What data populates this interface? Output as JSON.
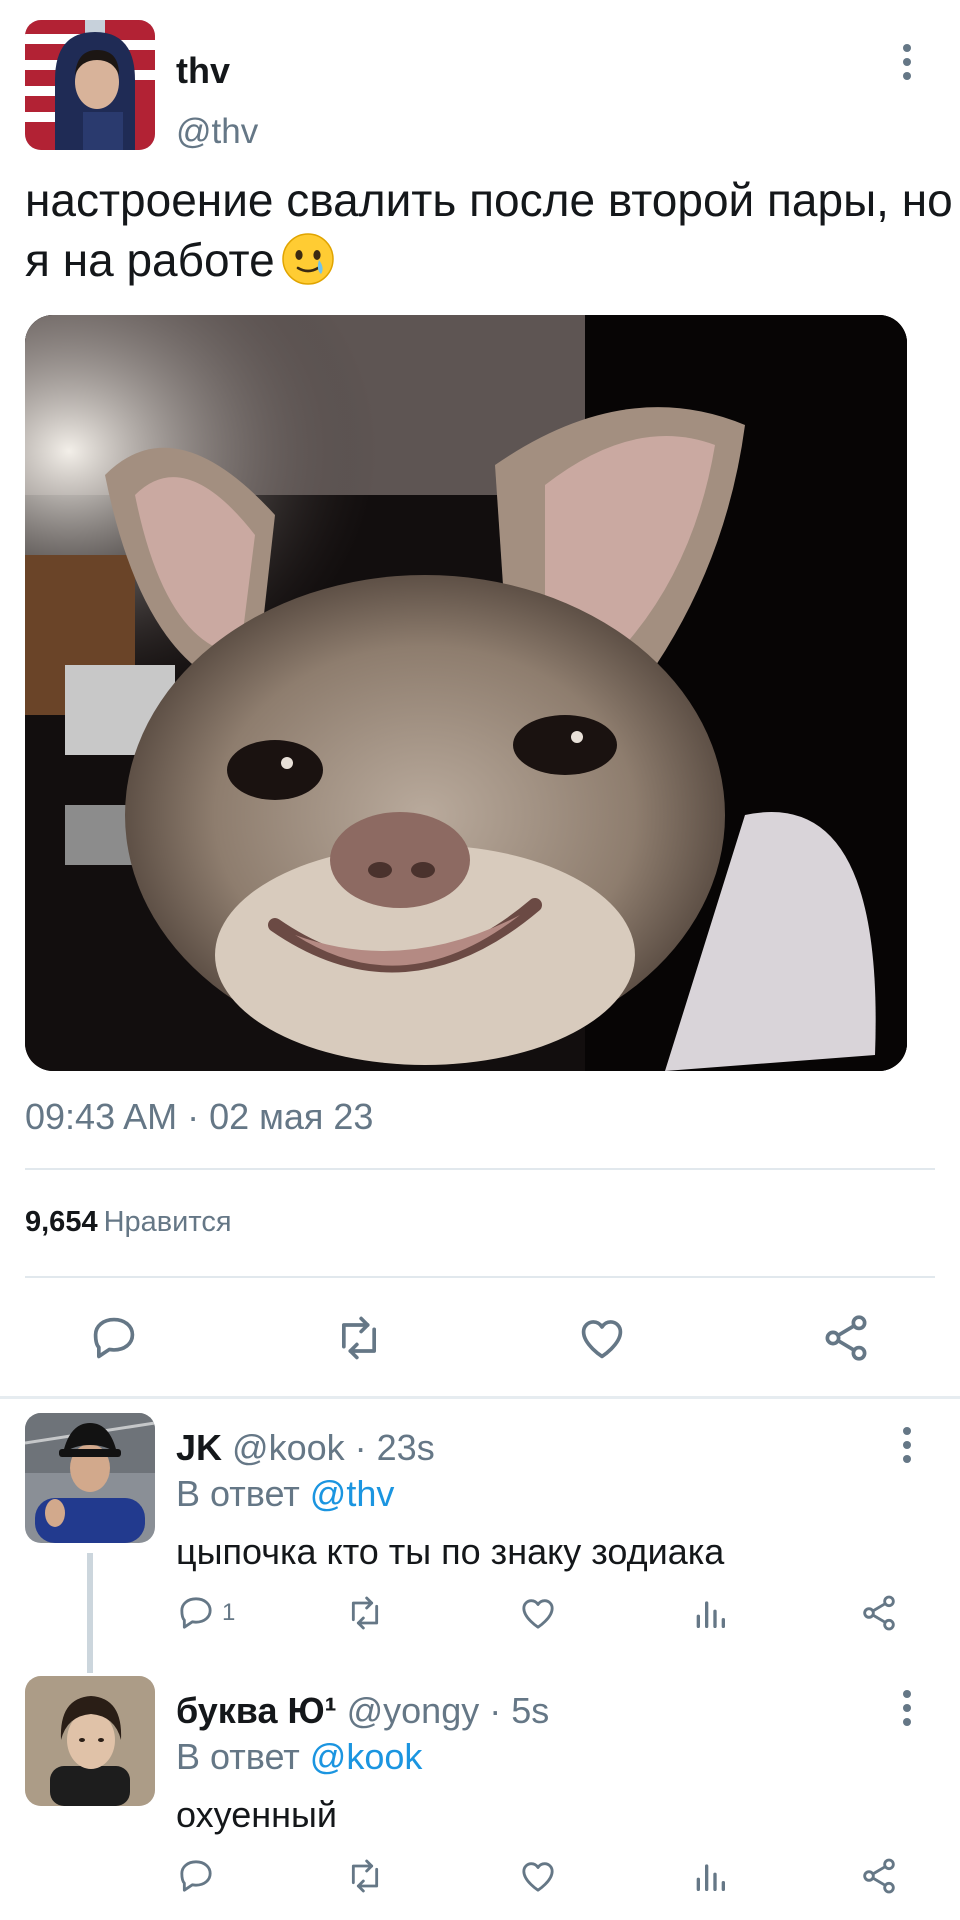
{
  "tweet": {
    "author_name": "thv",
    "author_handle": "@thv",
    "text": "настроение свалить после второй пары, но я на работе",
    "timestamp": "09:43 AM · 02 мая 23",
    "likes_count": "9,654",
    "likes_label": "Нравится",
    "emoji": "face-holding-back-tears"
  },
  "replies": [
    {
      "name": "JK",
      "handle": "@kook",
      "time": "· 23s",
      "replying_prefix": "В ответ",
      "replying_to": "@thv",
      "text": "цыпочка кто ты по знаку зодиака",
      "reply_count": "1"
    },
    {
      "name": "буква Ю¹",
      "handle": "@yongy",
      "time": "· 5s",
      "replying_prefix": "В ответ",
      "replying_to": "@kook",
      "text": "охуенный",
      "reply_count": ""
    }
  ],
  "icons": {
    "actions": [
      "reply-icon",
      "retweet-icon",
      "like-icon",
      "share-icon"
    ],
    "reply_actions": [
      "reply-icon",
      "retweet-icon",
      "like-icon",
      "analytics-icon",
      "share-icon"
    ]
  },
  "colors": {
    "text": "#14171a",
    "muted": "#657786",
    "link": "#1b95e0",
    "divider": "#e1e8ed"
  }
}
